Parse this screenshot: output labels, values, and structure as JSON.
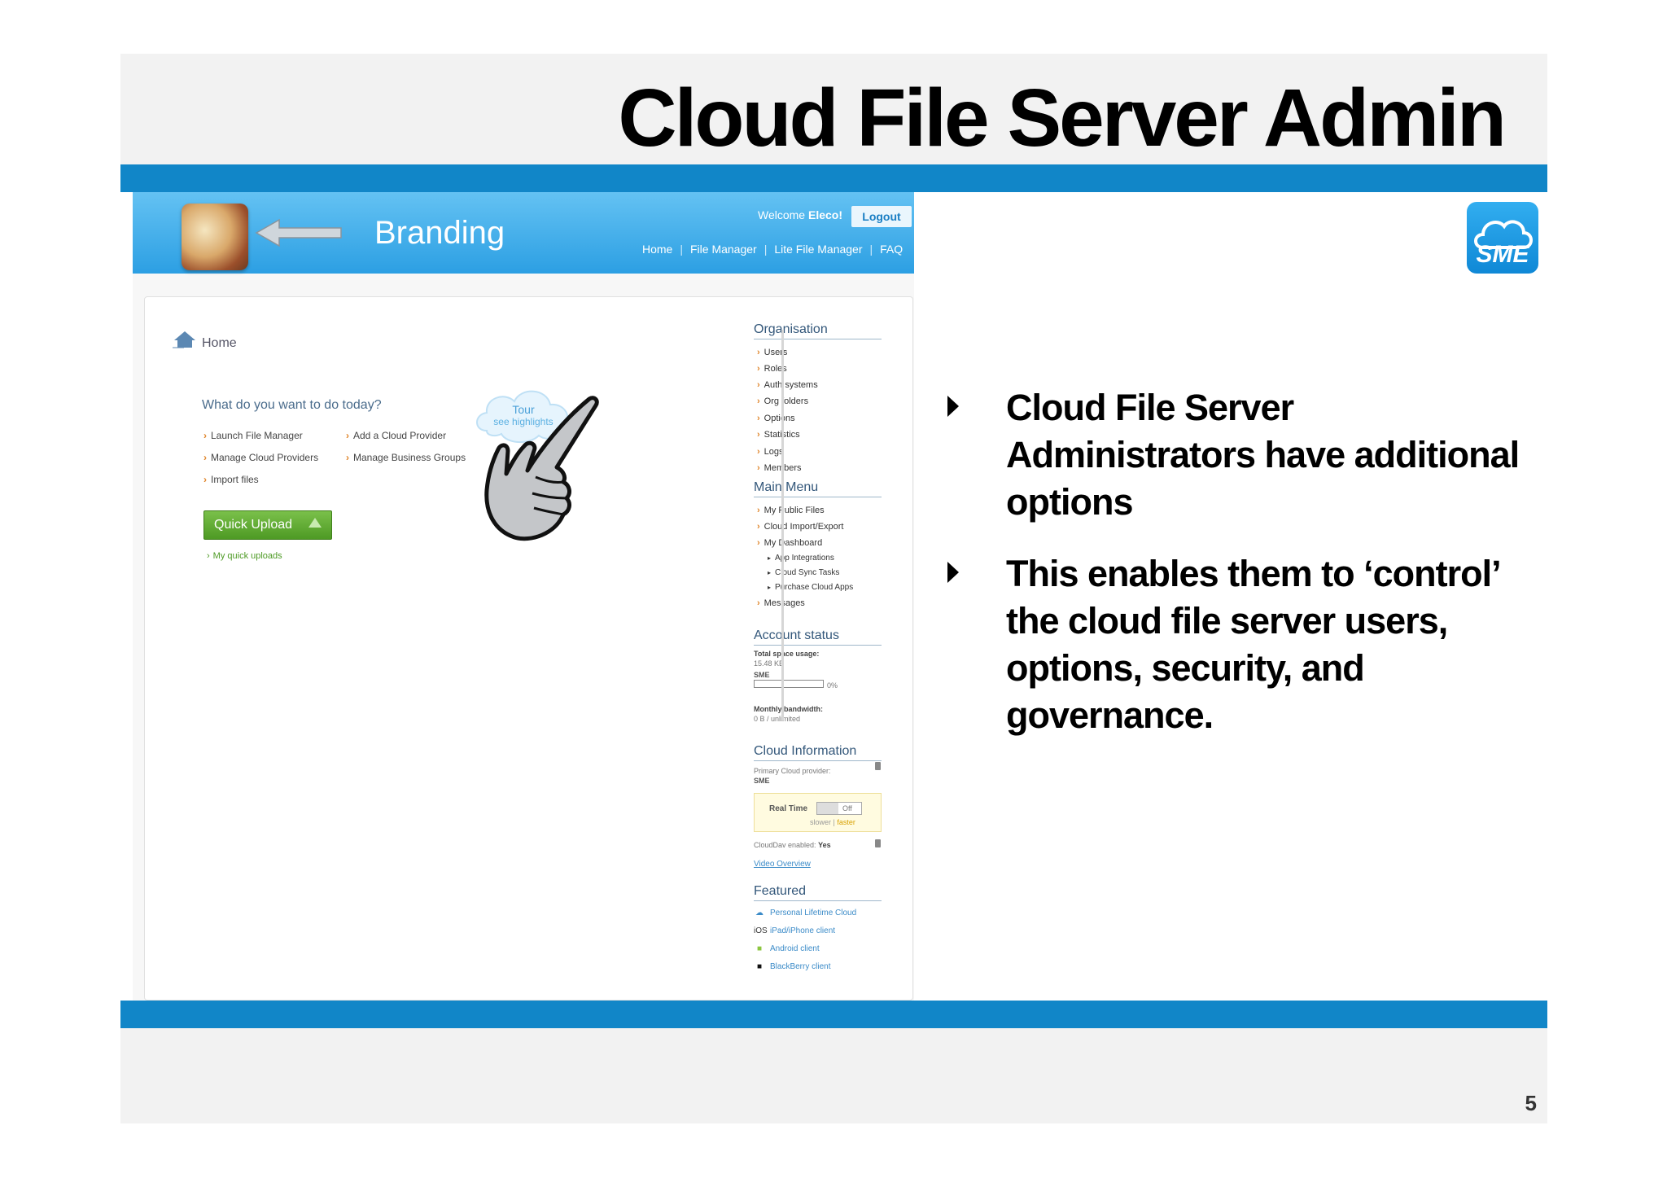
{
  "slide": {
    "title": "Cloud File Server Admin",
    "page_number": "5",
    "logo_text": "SME",
    "bullets": [
      "Cloud File Server Administrators have additional options",
      "This enables them to ‘control’ the cloud file server users, options, security, and governance."
    ]
  },
  "app": {
    "branding": "Branding",
    "welcome_prefix": "Welcome ",
    "welcome_user": "Eleco!",
    "logout": "Logout",
    "nav": [
      "Home",
      "File Manager",
      "Lite File Manager",
      "FAQ"
    ],
    "breadcrumb": "Home",
    "question": "What do you want to do today?",
    "tour": {
      "title": "Tour",
      "subtitle": "see highlights"
    },
    "tasks": [
      "Launch File Manager",
      "Add a Cloud Provider",
      "Manage Cloud Providers",
      "Manage Business Groups",
      "Import files"
    ],
    "quick_upload": "Quick Upload",
    "my_quick_uploads": "My quick uploads",
    "organisation": {
      "heading": "Organisation",
      "items": [
        "Users",
        "Roles",
        "Auth systems",
        "Org folders",
        "Options",
        "Statistics",
        "Logs",
        "Members"
      ]
    },
    "main_menu": {
      "heading": "Main Menu",
      "items": [
        "My Public Files",
        "Cloud Import/Export",
        "My Dashboard"
      ],
      "sub_items": [
        "App Integrations",
        "Cloud Sync Tasks",
        "Purchase Cloud Apps"
      ],
      "last_item": "Messages"
    },
    "account_status": {
      "heading": "Account status",
      "space_label": "Total space usage:",
      "space_value": "15.48 KB",
      "provider": "SME",
      "usage_percent": "0%",
      "usage_fraction": 0.0,
      "bandwidth_label": "Monthly bandwidth:",
      "bandwidth_value": "0 B / unlimited"
    },
    "cloud_info": {
      "heading": "Cloud Information",
      "primary_label": "Primary Cloud provider:",
      "primary_value": "SME",
      "realtime_label": "Real Time",
      "toggle_state": "Off",
      "slower": "slower",
      "separator": " | ",
      "faster": "faster",
      "clouddav_label": "CloudDav enabled: ",
      "clouddav_value": "Yes",
      "video": "Video Overview"
    },
    "featured": {
      "heading": "Featured",
      "ios_glyph": "iOS",
      "items": [
        "Personal Lifetime Cloud",
        "iPad/iPhone client",
        "Android client",
        "BlackBerry client"
      ]
    }
  },
  "colors": {
    "band": "#1186c8",
    "header_blue": "#2c9fe3",
    "quick_upload_green": "#5aa82c",
    "link_blue": "#3b8bc8"
  }
}
